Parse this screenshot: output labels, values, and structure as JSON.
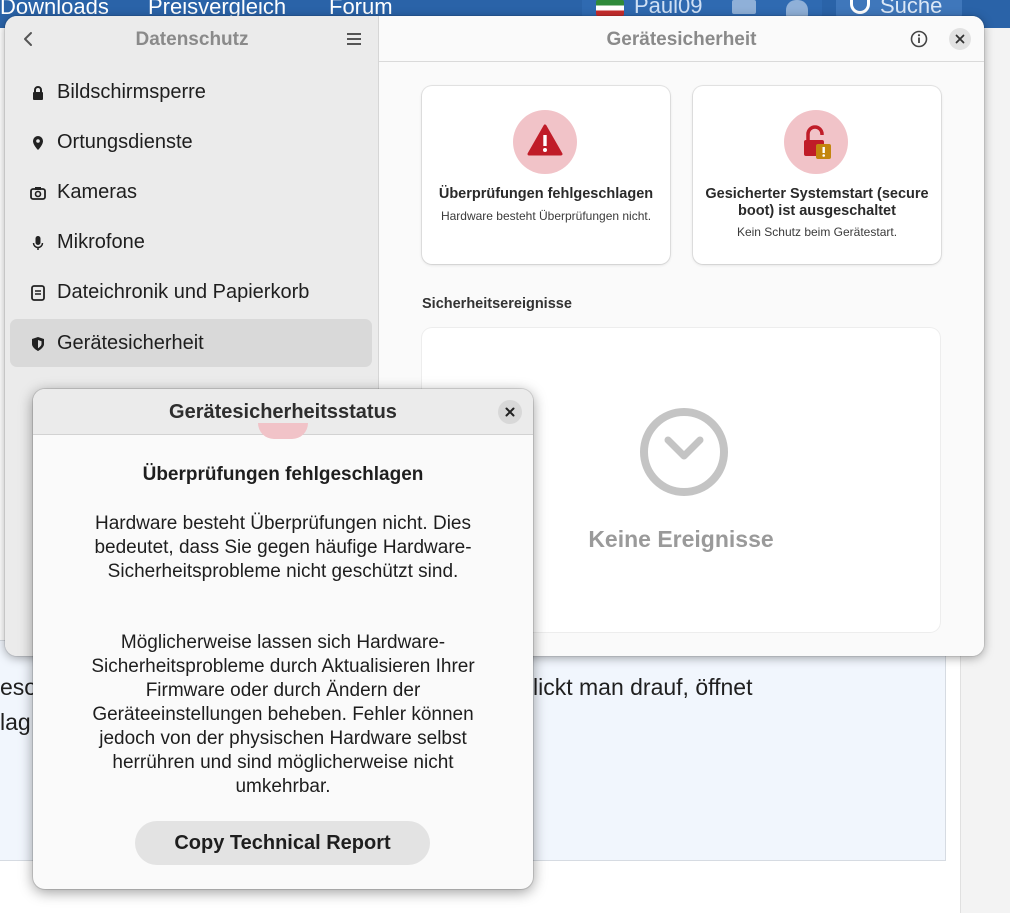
{
  "background": {
    "nav_items": [
      "Downloads",
      "Preisvergleich",
      "Forum"
    ],
    "username": "Paul09",
    "search_label": "Suche",
    "post_lines": [
      "lickt man drauf, öffnet"
    ],
    "post_fragments": [
      "eso",
      "lag"
    ]
  },
  "window": {
    "sidebar_title": "Datenschutz",
    "content_title": "Gerätesicherheit",
    "sidebar_items": [
      {
        "label": "Bildschirmsperre",
        "icon": "lock-icon"
      },
      {
        "label": "Ortungsdienste",
        "icon": "location-pin-icon"
      },
      {
        "label": "Kameras",
        "icon": "camera-icon"
      },
      {
        "label": "Mikrofone",
        "icon": "microphone-icon"
      },
      {
        "label": "Dateichronik und Papierkorb",
        "icon": "file-history-icon"
      },
      {
        "label": "Gerätesicherheit",
        "icon": "shield-icon",
        "selected": true
      }
    ],
    "cards": [
      {
        "title": "Überprüfungen fehlgeschlagen",
        "subtitle": "Hardware besteht Überprüfungen nicht.",
        "icon": "warning-icon"
      },
      {
        "title": "Gesicherter Systemstart (secure boot) ist ausgeschaltet",
        "subtitle": "Kein Schutz beim Gerätestart.",
        "icon": "unlocked-padlock-icon"
      }
    ],
    "events_title": "Sicherheitsereignisse",
    "events_empty": "Keine Ereignisse"
  },
  "dialog": {
    "title": "Gerätesicherheitsstatus",
    "heading": "Überprüfungen fehlgeschlagen",
    "paragraph1": "Hardware besteht Überprüfungen nicht. Dies bedeutet, dass Sie gegen häufige Hardware-Sicherheitsprobleme nicht geschützt sind.",
    "paragraph2": "Möglicherweise lassen sich Hardware-Sicherheitsprobleme durch Aktualisieren Ihrer Firmware oder durch Ändern der Geräteeinstellungen beheben. Fehler können jedoch von der physischen Hardware selbst herrühren und sind möglicherweise nicht umkehrbar.",
    "button": "Copy Technical Report"
  },
  "colors": {
    "accent_red": "#c01c28",
    "warning_bg": "#f1c3c8",
    "topbar_blue": "#2a63a8",
    "selected_bg": "#d9d9d9"
  }
}
